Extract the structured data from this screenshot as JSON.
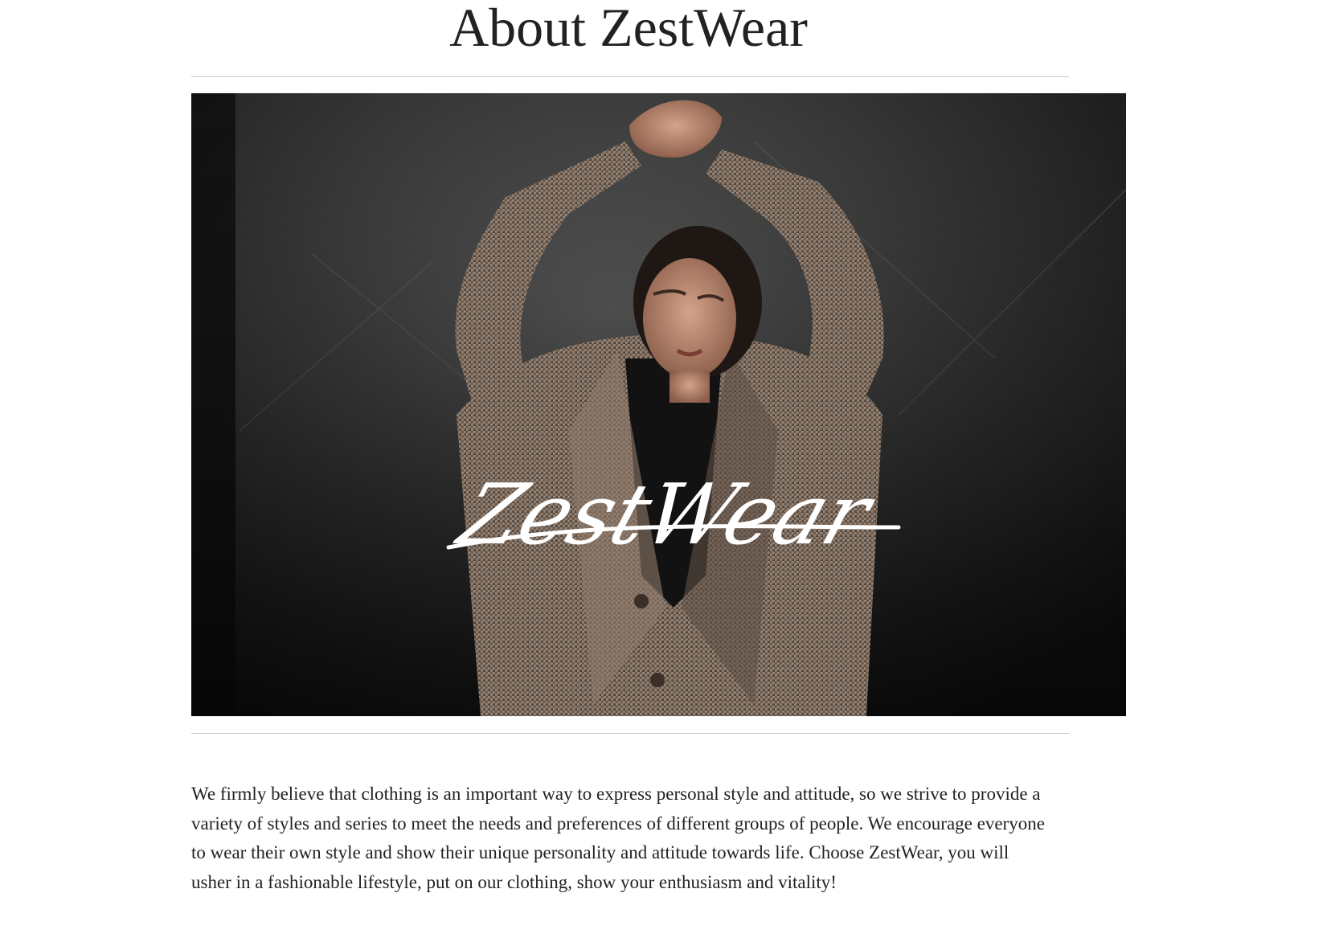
{
  "page": {
    "title": "About ZestWear"
  },
  "hero": {
    "logo_text": "ZestWear",
    "logo_color": "#ffffff",
    "background_color": "#2b2b2b"
  },
  "about": {
    "paragraph": "We firmly believe that clothing is an important way to express personal style and attitude, so we strive to provide a variety of styles and series to meet the needs and preferences of different groups of people. We encourage everyone to wear their own style and show their unique personality and attitude towards life. Choose ZestWear, you will usher in a fashionable lifestyle, put on our clothing, show your enthusiasm and vitality!"
  }
}
